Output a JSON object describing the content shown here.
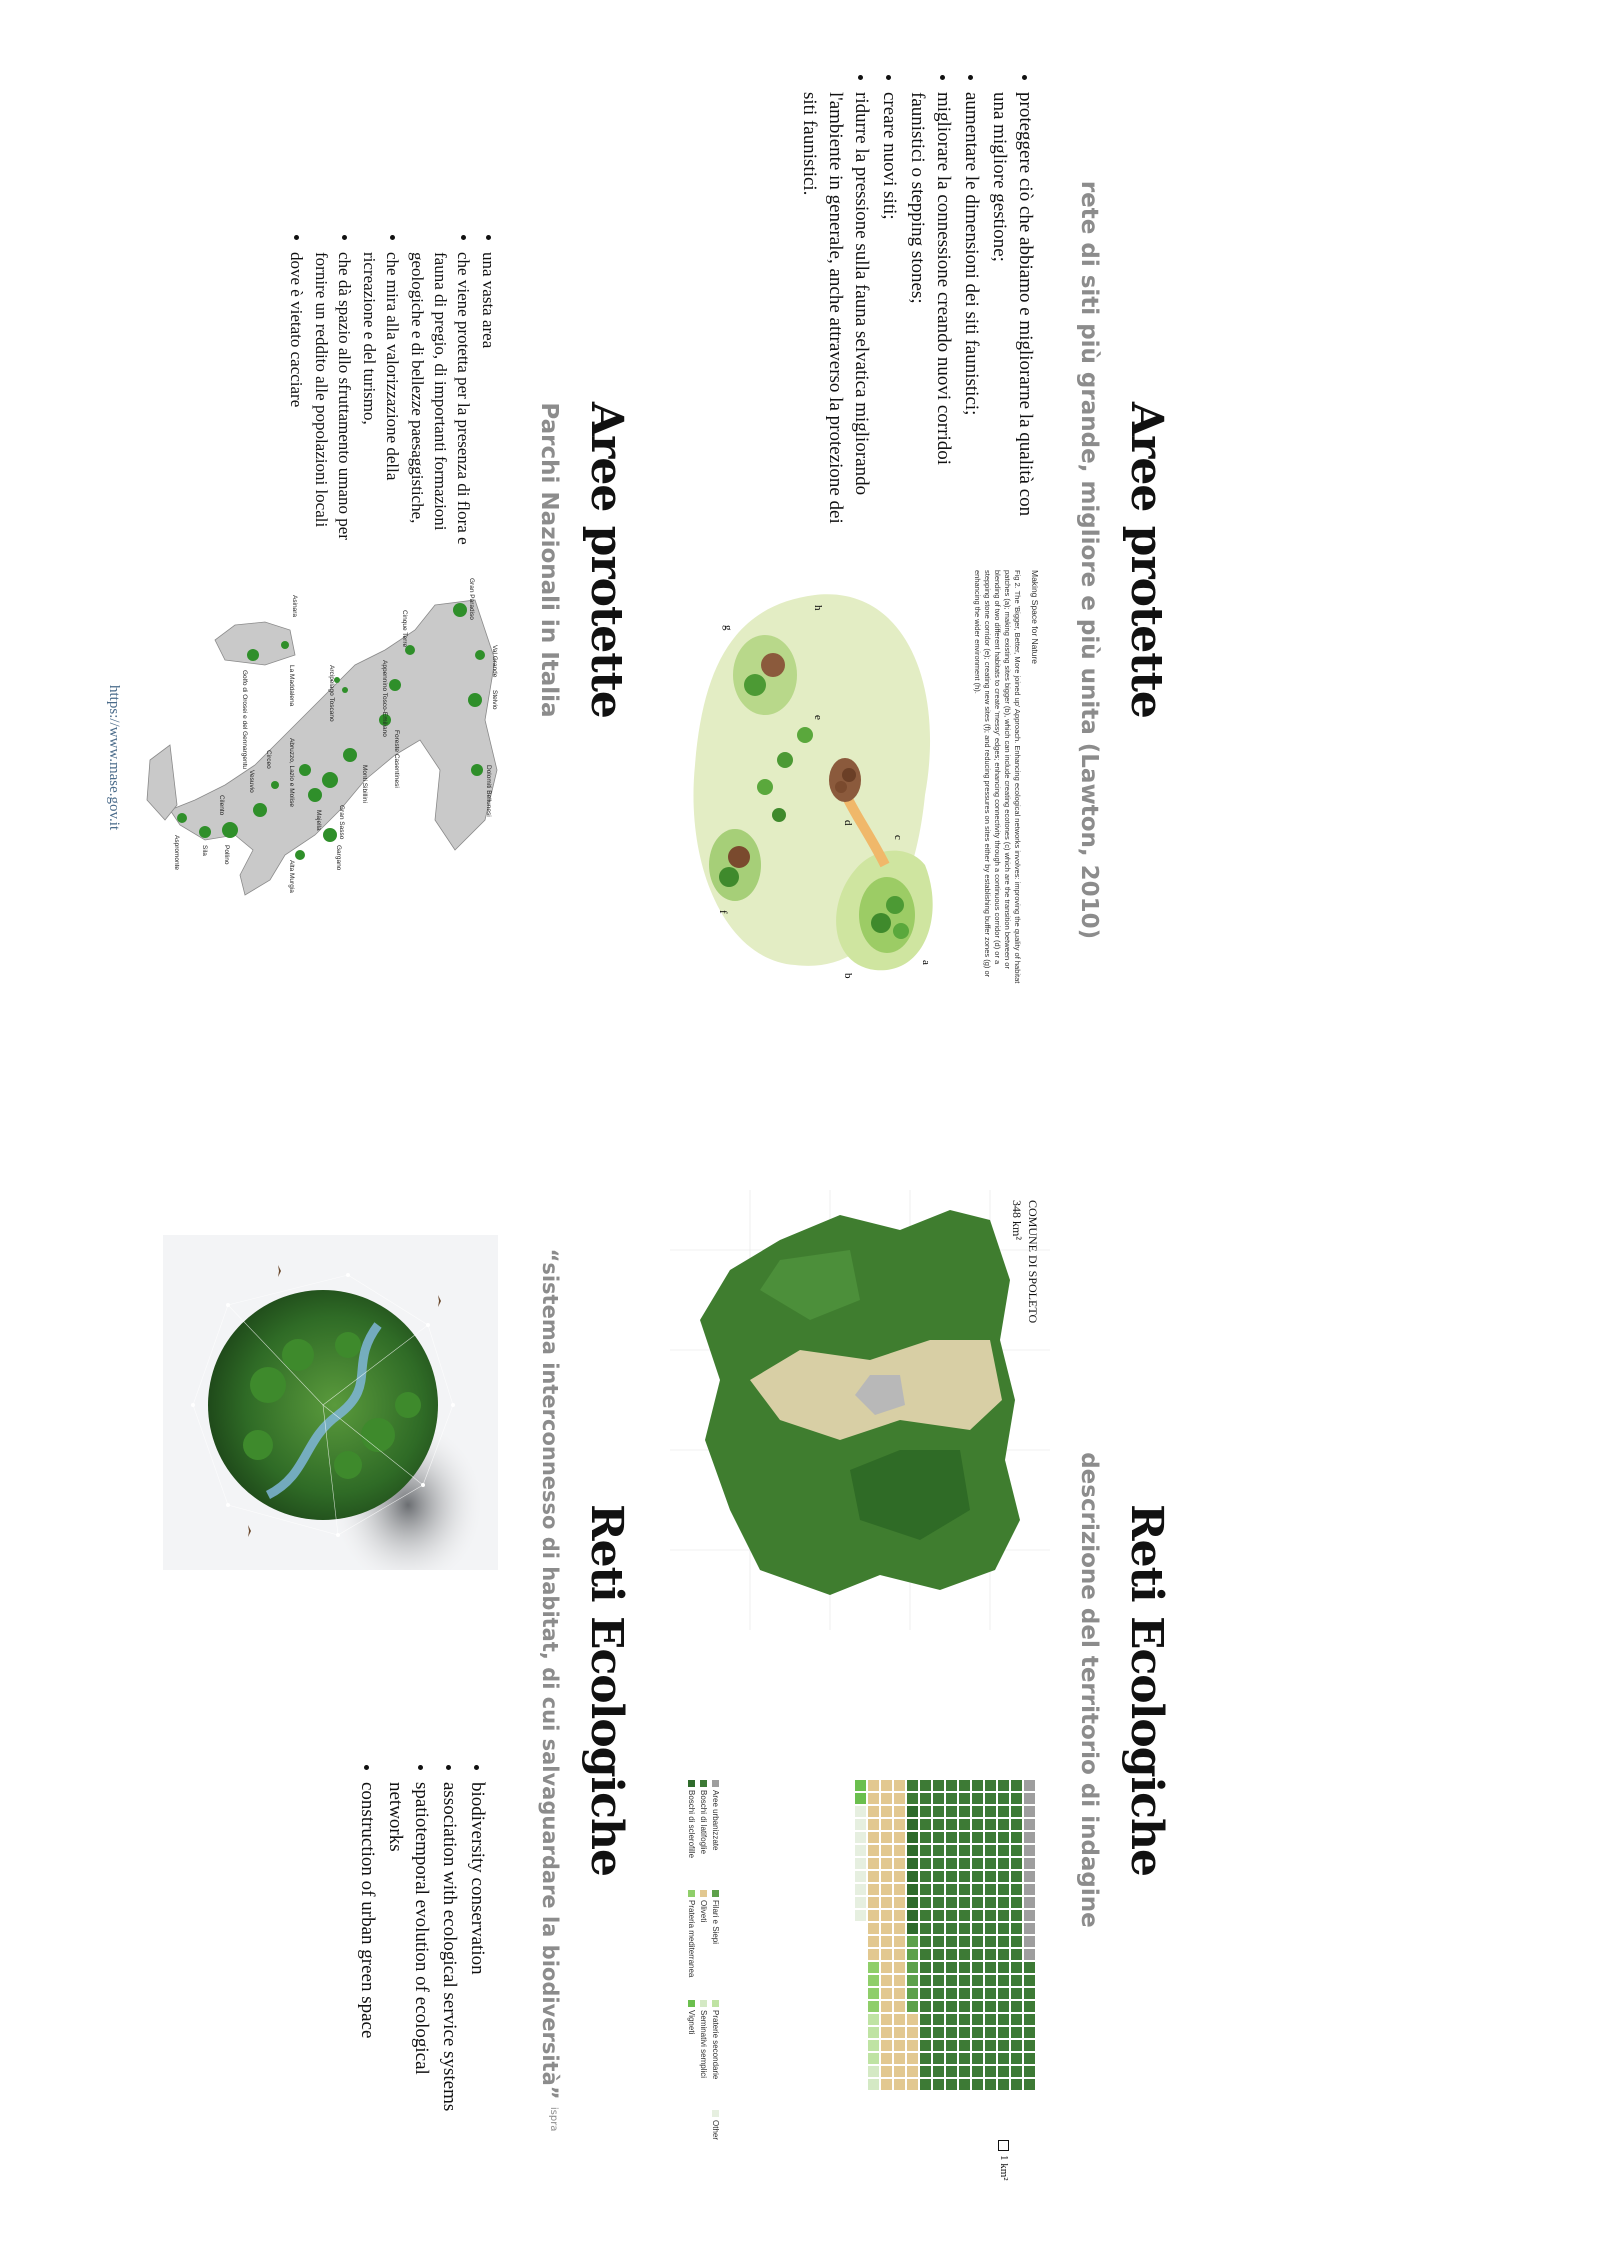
{
  "slide_lawton": {
    "title": "Aree protette",
    "subtitle": "rete di siti più grande, migliore e più unita (Lawton, 2010)",
    "bullets": [
      "proteggere ciò che abbiamo e migliorarne la qualità con una migliore gestione;",
      "aumentare le dimensioni dei siti faunistici;",
      "migliorare la connessione creando nuovi corridoi faunistici o stepping stones;",
      "creare nuovi siti;",
      "ridurre la pressione sulla fauna selvatica migliorando l'ambiente in generale, anche attraverso la protezione dei siti faunistici."
    ],
    "figure_title": "Making Space for Nature",
    "figure_caption": "Fig 2. The 'Bigger, Better, More joined up' Approach. Enhancing ecological networks involves: improving the quality of habitat patches (a); making existing sites bigger (b), which can include creating ecotones (c) which are the transition between or blending of two different habitats to create 'messy' edges; enhancing connectivity through a continuous corridor (d) or a stepping stone corridor (e); creating new sites (f); and reducing pressures on sites either by establishing buffer zones (g) or enhancing the wider environment (h).",
    "figure_letters": [
      "a",
      "b",
      "c",
      "d",
      "e",
      "f",
      "g",
      "h"
    ]
  },
  "slide_parchi": {
    "title": "Aree protette",
    "subtitle": "Parchi Nazionali in Italia",
    "bullets": [
      "una vasta area",
      "che viene protetta per la presenza di flora e fauna di pregio, di importanti formazioni geologiche e di bellezze paesaggistiche,",
      "che mira alla valorizzazione della ricreazione e del turismo,",
      "che dà spazio allo sfruttamento umano per fornire un reddito alle popolazioni locali",
      "dove è vietato cacciare"
    ],
    "source_link": "https://www.mase.gov.it",
    "map_labels": [
      "Gran Paradiso",
      "Val Grande",
      "Stelvio",
      "Dolomiti Bellunesi",
      "Cinque Terre",
      "Appennino Tosco-Emiliano",
      "Foreste Casentinesi",
      "Arcipelago Toscano",
      "Monti Sibillini",
      "Gran Sasso",
      "Majella",
      "Abruzzo, Lazio e Molise",
      "Circeo",
      "Gargano",
      "Alta Murgia",
      "Vesuvio",
      "Cilento",
      "Pollino",
      "Sila",
      "Aspromonte",
      "Asinara",
      "La Maddalena",
      "Golfo di Orosei e del Gennargentu"
    ],
    "colors": {
      "map_land": "#c9c9c9",
      "park_green": "#2f8f2a"
    }
  },
  "slide_spoleto": {
    "title": "Reti Ecologiche",
    "subtitle": "descrizione del territorio di indagine",
    "map_title": "COMUNE DI SPOLETO",
    "map_area": "348 km²",
    "unit_label": "1 km²",
    "chart_data": {
      "type": "waffle",
      "unit": "1 km²",
      "categories": [
        "Aree urbanizzate",
        "Boschi di latifoglie",
        "Boschi di sclerofille",
        "Filari e Siepi",
        "Oliveti",
        "Prateria mediterranea",
        "Praterie secondarie",
        "Seminativi semplici",
        "Vigneti",
        "Other"
      ],
      "values": [
        14,
        204,
        10,
        6,
        68,
        4,
        4,
        2,
        2,
        9
      ],
      "colors": [
        "#9e9e9e",
        "#3d7a35",
        "#2f6b2c",
        "#5ea14b",
        "#e2c890",
        "#8fce6a",
        "#bfe3a3",
        "#d4e9c4",
        "#6bbf4e",
        "#e6efe0"
      ]
    },
    "legend": [
      "Aree urbanizzate",
      "Boschi di latifoglie",
      "Boschi di sclerofille",
      "Filari e Siepi",
      "Oliveti",
      "Prateria mediterranea",
      "Praterie secondarie",
      "Seminativi semplici",
      "Vigneti",
      "Other"
    ]
  },
  "slide_reti": {
    "title": "Reti Ecologiche",
    "subtitle": "“sistema interconnesso di habitat, di cui salvaguardare la biodiversità”",
    "subtitle_note": "ispra",
    "bullets": [
      "biodiversity conservation",
      "association with ecological service systems",
      "spatiotemporal evolution of ecological networks",
      "construction of urban green space"
    ]
  }
}
